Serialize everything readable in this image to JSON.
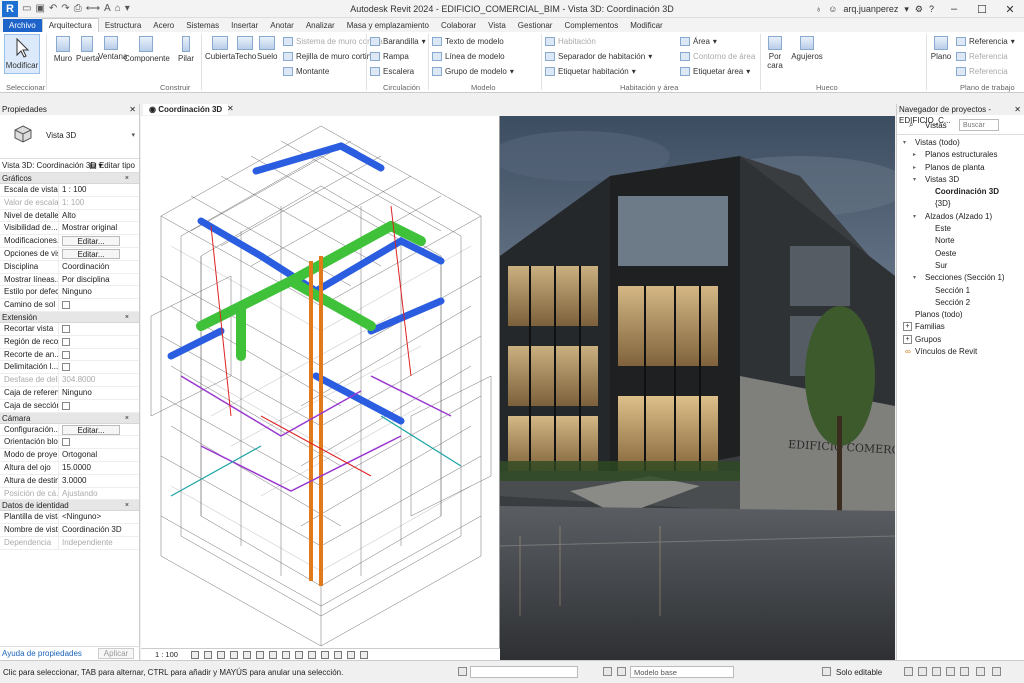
{
  "app": {
    "title": "Autodesk Revit 2024 - EDIFICIO_COMERCIAL_BIM - Vista 3D: Coordinación 3D",
    "user": "arq.juanperez",
    "logo": "R"
  },
  "tabs": [
    "Archivo",
    "Arquitectura",
    "Estructura",
    "Acero",
    "Sistemas",
    "Insertar",
    "Anotar",
    "Analizar",
    "Masa y emplazamiento",
    "Colaborar",
    "Vista",
    "Gestionar",
    "Complementos",
    "Modificar"
  ],
  "ribbon": {
    "modify": "Modificar",
    "select": "Seleccionar",
    "muro": "Muro",
    "puerta": "Puerta",
    "ventana": "Ventana",
    "componente": "Componente",
    "pilar": "Pilar",
    "cubierta": "Cubierta",
    "techo": "Techo",
    "suelo": "Suelo",
    "sistema_muro": "Sistema de muro cortina",
    "rejilla_muro": "Rejilla de muro cortina",
    "montante": "Montante",
    "barandilla": "Barandilla",
    "rampa": "Rampa",
    "escalera": "Escalera",
    "texto": "Texto de modelo",
    "linea": "Línea de modelo",
    "grupo": "Grupo de modelo",
    "habitacion": "Habitación",
    "separador": "Separador de habitación",
    "etiquetar_hab": "Etiquetar habitación",
    "area": "Área",
    "contorno": "Contorno de área",
    "etiquetar_area": "Etiquetar área",
    "por_cara": "Por cara",
    "agujeros": "Agujeros",
    "ref1": "Referencia",
    "ref2": "Referencia",
    "ref3": "Referencia",
    "plano": "Plano",
    "g_construir": "Construir",
    "g_circulacion": "Circulación",
    "g_modelo": "Modelo",
    "g_habitacion": "Habitación y área",
    "g_hueco": "Hueco",
    "g_referencia": "Referencia",
    "g_plano": "Plano de trabajo"
  },
  "properties": {
    "title": "Propiedades",
    "type_name": "Vista 3D",
    "filter": "Vista 3D: Coordinación 3D",
    "edit_type": "Editar tipo",
    "sections": {
      "graficos": "Gráficos",
      "extension": "Extensión",
      "camara": "Cámara",
      "identidad": "Datos de identidad"
    },
    "graficos": [
      {
        "k": "Escala de vista",
        "v": "1 : 100"
      },
      {
        "k": "Valor de escala",
        "v": "1:   100",
        "dis": true
      },
      {
        "k": "Nivel de detalle",
        "v": "Alto"
      },
      {
        "k": "Visibilidad de...",
        "v": "Mostrar original"
      },
      {
        "k": "Modificaciones...",
        "v": "Editar..."
      },
      {
        "k": "Opciones de vis...",
        "v": "Editar..."
      },
      {
        "k": "Disciplina",
        "v": "Coordinación"
      },
      {
        "k": "Mostrar líneas...",
        "v": "Por disciplina"
      },
      {
        "k": "Estilo por defec...",
        "v": "Ninguno"
      },
      {
        "k": "Camino de sol",
        "v": ""
      }
    ],
    "extension": [
      {
        "k": "Recortar vista",
        "v": ""
      },
      {
        "k": "Región de reco...",
        "v": ""
      },
      {
        "k": "Recorte de an...",
        "v": ""
      },
      {
        "k": "Delimitación l...",
        "v": ""
      },
      {
        "k": "Desfase de deli...",
        "v": "304.8000",
        "dis": true
      },
      {
        "k": "Caja de referen...",
        "v": "Ninguno"
      },
      {
        "k": "Caja de sección",
        "v": ""
      }
    ],
    "camara": [
      {
        "k": "Configuración...",
        "v": "Editar..."
      },
      {
        "k": "Orientación blo...",
        "v": ""
      },
      {
        "k": "Modo de proye...",
        "v": "Ortogonal"
      },
      {
        "k": "Altura del ojo",
        "v": "15.0000"
      },
      {
        "k": "Altura de destin...",
        "v": "3.0000"
      },
      {
        "k": "Posición de cá...",
        "v": "Ajustando",
        "dis": true
      }
    ],
    "identidad": [
      {
        "k": "Plantilla de vista",
        "v": "<Ninguno>"
      },
      {
        "k": "Nombre de vista",
        "v": "Coordinación 3D"
      },
      {
        "k": "Dependencia",
        "v": "Independiente",
        "dis": true
      }
    ],
    "help": "Ayuda de propiedades",
    "apply": "Aplicar"
  },
  "view": {
    "tab": "Coordinación 3D",
    "scale": "1 : 100"
  },
  "render": {
    "sign": "EDIFICIO COMERCIAL"
  },
  "browser": {
    "title": "Navegador de proyectos - EDIFICIO_C...",
    "search_label": "Vistas",
    "search_value": "Buscar",
    "items": [
      {
        "t": "Vistas (todo)",
        "l": 0,
        "ex": "v"
      },
      {
        "t": "Planos estructurales",
        "l": 1,
        "ex": ">"
      },
      {
        "t": "Planos de planta",
        "l": 1,
        "ex": ">"
      },
      {
        "t": "Vistas 3D",
        "l": 1,
        "ex": "v"
      },
      {
        "t": "Coordinación 3D",
        "l": 2,
        "sel": true
      },
      {
        "t": "{3D}",
        "l": 2
      },
      {
        "t": "Alzados (Alzado 1)",
        "l": 1,
        "ex": "v"
      },
      {
        "t": "Este",
        "l": 2
      },
      {
        "t": "Norte",
        "l": 2
      },
      {
        "t": "Oeste",
        "l": 2
      },
      {
        "t": "Sur",
        "l": 2
      },
      {
        "t": "Secciones (Sección 1)",
        "l": 1,
        "ex": "v"
      },
      {
        "t": "Sección 1",
        "l": 2
      },
      {
        "t": "Sección 2",
        "l": 2
      },
      {
        "t": "Planos (todo)",
        "l": 0
      },
      {
        "t": "Familias",
        "l": 0,
        "box": "+"
      },
      {
        "t": "Grupos",
        "l": 0,
        "box": "+"
      },
      {
        "t": "Vínculos de Revit",
        "l": 0,
        "link": true
      }
    ]
  },
  "status": {
    "message": "Clic para seleccionar, TAB para alternar, CTRL para añadir y MAYÚS para anular una selección.",
    "model": "Modelo base",
    "editable": "Solo editable"
  },
  "colors": {
    "accent": "#1d63c9",
    "duct_blue": "#2a5de0",
    "duct_green": "#3fc23a",
    "pipe_orange": "#e07a1d",
    "pipe_purple": "#9a3ad0",
    "pipe_red": "#d22"
  }
}
